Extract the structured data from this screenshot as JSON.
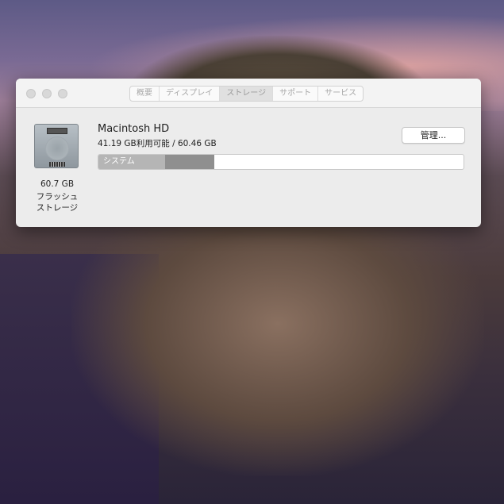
{
  "tabs": [
    {
      "label": "概要",
      "active": false
    },
    {
      "label": "ディスプレイ",
      "active": false
    },
    {
      "label": "ストレージ",
      "active": true
    },
    {
      "label": "サポート",
      "active": false
    },
    {
      "label": "サービス",
      "active": false
    }
  ],
  "disk": {
    "capacity": "60.7 GB",
    "type_line1": "フラッシュ",
    "type_line2": "ストレージ"
  },
  "volume": {
    "name": "Macintosh HD",
    "info": "41.19 GB利用可能 / 60.46 GB",
    "manage_label": "管理..."
  },
  "usage_bar": {
    "system_label": "システム",
    "system_percent": 18.2,
    "other_percent": 13.5,
    "colors": {
      "system": "#b5b5b5",
      "other": "#8f8f8f",
      "free": "#ffffff"
    }
  }
}
